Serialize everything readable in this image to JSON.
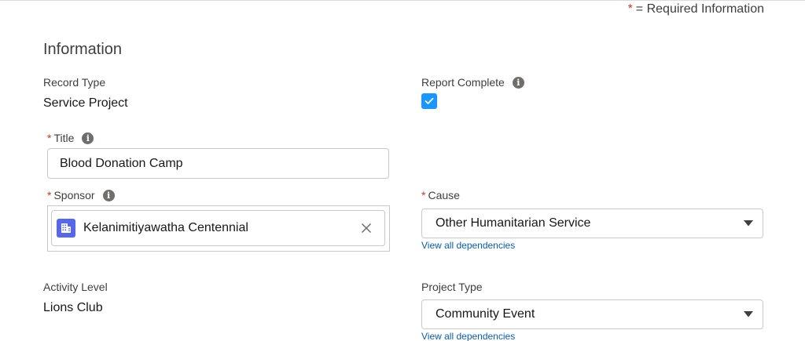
{
  "header": {
    "required_star": "*",
    "required_text": "= Required Information"
  },
  "section": {
    "title": "Information"
  },
  "fields": {
    "record_type": {
      "label": "Record Type",
      "value": "Service Project"
    },
    "report_complete": {
      "label": "Report Complete",
      "checked": true
    },
    "title": {
      "star": "*",
      "label": "Title",
      "value": "Blood Donation Camp"
    },
    "sponsor": {
      "star": "*",
      "label": "Sponsor",
      "value": "Kelanimitiyawatha Centennial",
      "icon": "account-icon"
    },
    "cause": {
      "star": "*",
      "label": "Cause",
      "value": "Other Humanitarian Service",
      "link": "View all dependencies"
    },
    "activity_level": {
      "label": "Activity Level",
      "value": "Lions Club"
    },
    "project_type": {
      "label": "Project Type",
      "value": "Community Event",
      "link": "View all dependencies"
    }
  },
  "icons": {
    "info": "i",
    "clear": "close-icon",
    "dropdown": "caret-down-icon",
    "check": "check-icon"
  },
  "colors": {
    "required": "#c23934",
    "checkbox": "#1b96ff",
    "sponsor_icon": "#5867e8",
    "link": "#0b5cab",
    "info_icon": "#706e6b"
  }
}
